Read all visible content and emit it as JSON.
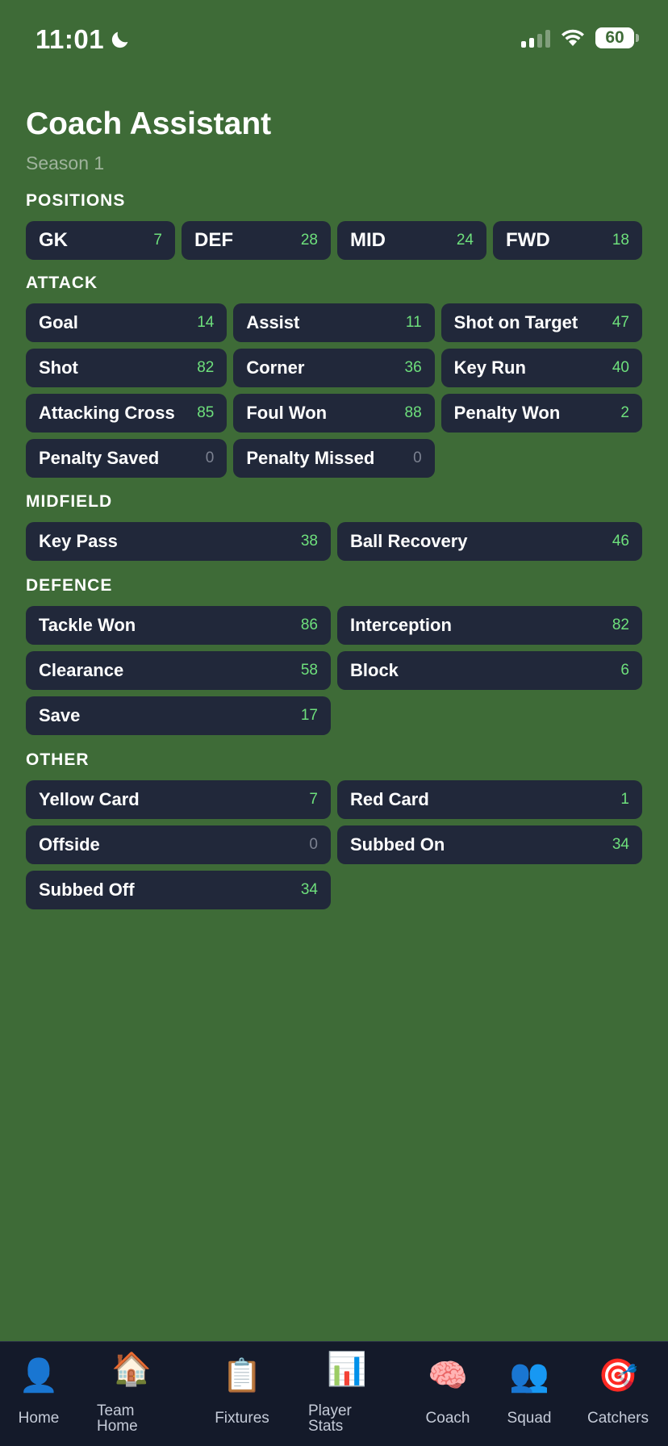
{
  "status_bar": {
    "time": "11:01",
    "battery": "60"
  },
  "header": {
    "title": "Coach Assistant",
    "subtitle": "Season 1"
  },
  "sections": {
    "positions": {
      "heading": "POSITIONS",
      "items": [
        {
          "label": "GK",
          "count": "7"
        },
        {
          "label": "DEF",
          "count": "28"
        },
        {
          "label": "MID",
          "count": "24"
        },
        {
          "label": "FWD",
          "count": "18"
        }
      ]
    },
    "attack": {
      "heading": "ATTACK",
      "items": [
        {
          "label": "Goal",
          "count": "14"
        },
        {
          "label": "Assist",
          "count": "11"
        },
        {
          "label": "Shot on Target",
          "count": "47"
        },
        {
          "label": "Shot",
          "count": "82"
        },
        {
          "label": "Corner",
          "count": "36"
        },
        {
          "label": "Key Run",
          "count": "40"
        },
        {
          "label": "Attacking Cross",
          "count": "85"
        },
        {
          "label": "Foul Won",
          "count": "88"
        },
        {
          "label": "Penalty Won",
          "count": "2"
        },
        {
          "label": "Penalty Saved",
          "count": "0"
        },
        {
          "label": "Penalty Missed",
          "count": "0"
        }
      ]
    },
    "midfield": {
      "heading": "MIDFIELD",
      "items": [
        {
          "label": "Key Pass",
          "count": "38"
        },
        {
          "label": "Ball Recovery",
          "count": "46"
        }
      ]
    },
    "defence": {
      "heading": "DEFENCE",
      "items": [
        {
          "label": "Tackle Won",
          "count": "86"
        },
        {
          "label": "Interception",
          "count": "82"
        },
        {
          "label": "Clearance",
          "count": "58"
        },
        {
          "label": "Block",
          "count": "6"
        },
        {
          "label": "Save",
          "count": "17"
        }
      ]
    },
    "other": {
      "heading": "OTHER",
      "items": [
        {
          "label": "Yellow Card",
          "count": "7"
        },
        {
          "label": "Red Card",
          "count": "1"
        },
        {
          "label": "Offside",
          "count": "0"
        },
        {
          "label": "Subbed On",
          "count": "34"
        },
        {
          "label": "Subbed Off",
          "count": "34"
        }
      ]
    }
  },
  "tab_bar": {
    "tabs": [
      {
        "label": "Home",
        "icon": "👤",
        "icon_name": "user-icon"
      },
      {
        "label": "Team\nHome",
        "icon": "🏠",
        "icon_name": "house-icon"
      },
      {
        "label": "Fixtures",
        "icon": "📋",
        "icon_name": "clipboard-icon"
      },
      {
        "label": "Player\nStats",
        "icon": "📊",
        "icon_name": "bar-chart-icon"
      },
      {
        "label": "Coach",
        "icon": "🧠",
        "icon_name": "brain-icon"
      },
      {
        "label": "Squad",
        "icon": "👥",
        "icon_name": "users-icon"
      },
      {
        "label": "Catchers",
        "icon": "🎯",
        "icon_name": "target-icon"
      }
    ]
  },
  "colors": {
    "background": "#3e6b37",
    "card": "#21283a",
    "count_positive": "#6ee07c",
    "count_zero": "#7c8291",
    "tab_bar": "#141a2a"
  }
}
